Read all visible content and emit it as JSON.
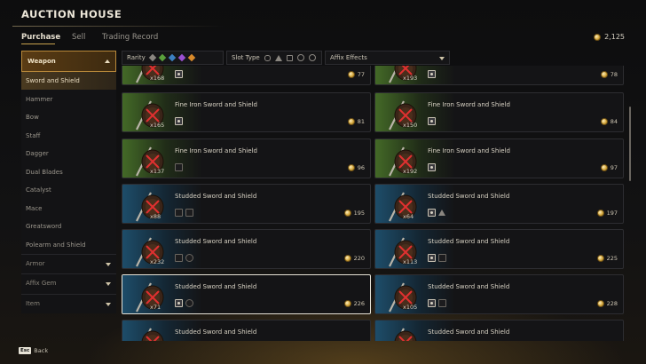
{
  "header": {
    "title": "AUCTION HOUSE"
  },
  "tabs": [
    {
      "label": "Purchase",
      "active": true
    },
    {
      "label": "Sell",
      "active": false
    },
    {
      "label": "Trading Record",
      "active": false
    }
  ],
  "currency": {
    "balance": "2,125",
    "icon": "gold-coin-icon"
  },
  "sidebar": {
    "category": "Weapon",
    "items": [
      {
        "label": "Sword and Shield",
        "selected": true
      },
      {
        "label": "Hammer"
      },
      {
        "label": "Bow"
      },
      {
        "label": "Staff"
      },
      {
        "label": "Dagger"
      },
      {
        "label": "Dual Blades"
      },
      {
        "label": "Catalyst"
      },
      {
        "label": "Mace"
      },
      {
        "label": "Greatsword"
      },
      {
        "label": "Polearm and Shield"
      }
    ],
    "categories": [
      {
        "label": "Armor"
      },
      {
        "label": "Affix Gem"
      },
      {
        "label": "Item"
      }
    ]
  },
  "filters": {
    "rarity_label": "Rarity",
    "rarity_colors": [
      "#8a8680",
      "#5aa03c",
      "#3c7fc0",
      "#9b4fd0",
      "#d98a2a"
    ],
    "slot_type_label": "Slot Type",
    "affix_label": "Affix Effects"
  },
  "listings": [
    {
      "name": "",
      "qty": "x168",
      "price": "77",
      "tier": "green",
      "affixes": [
        "fill"
      ]
    },
    {
      "name": "",
      "qty": "x193",
      "price": "78",
      "tier": "green",
      "affixes": [
        "fill"
      ]
    },
    {
      "name": "Fine Iron Sword and Shield",
      "qty": "x165",
      "price": "81",
      "tier": "green",
      "affixes": [
        "fill"
      ]
    },
    {
      "name": "Fine Iron Sword and Shield",
      "qty": "x150",
      "price": "84",
      "tier": "green",
      "affixes": [
        "fill"
      ]
    },
    {
      "name": "Fine Iron Sword and Shield",
      "qty": "x137",
      "price": "96",
      "tier": "green",
      "affixes": [
        "sq"
      ]
    },
    {
      "name": "Fine Iron Sword and Shield",
      "qty": "x192",
      "price": "97",
      "tier": "green",
      "affixes": [
        "fill"
      ]
    },
    {
      "name": "Studded Sword and Shield",
      "qty": "x88",
      "price": "195",
      "tier": "blue",
      "affixes": [
        "sq",
        "sq"
      ]
    },
    {
      "name": "Studded Sword and Shield",
      "qty": "x64",
      "price": "197",
      "tier": "blue",
      "affixes": [
        "fill",
        "tri"
      ]
    },
    {
      "name": "Studded Sword and Shield",
      "qty": "x232",
      "price": "220",
      "tier": "blue",
      "affixes": [
        "sq",
        "c"
      ]
    },
    {
      "name": "Studded Sword and Shield",
      "qty": "x113",
      "price": "225",
      "tier": "blue",
      "affixes": [
        "fill",
        "sq"
      ]
    },
    {
      "name": "Studded Sword and Shield",
      "qty": "x71",
      "price": "226",
      "tier": "blue",
      "affixes": [
        "fill",
        "c"
      ],
      "highlighted": true
    },
    {
      "name": "Studded Sword and Shield",
      "qty": "x105",
      "price": "228",
      "tier": "blue",
      "affixes": [
        "fill",
        "sq"
      ]
    },
    {
      "name": "Studded Sword and Shield",
      "qty": "",
      "price": "",
      "tier": "blue",
      "affixes": []
    },
    {
      "name": "Studded Sword and Shield",
      "qty": "",
      "price": "",
      "tier": "blue",
      "affixes": []
    }
  ],
  "footer": {
    "key": "Esc",
    "back_label": "Back"
  }
}
